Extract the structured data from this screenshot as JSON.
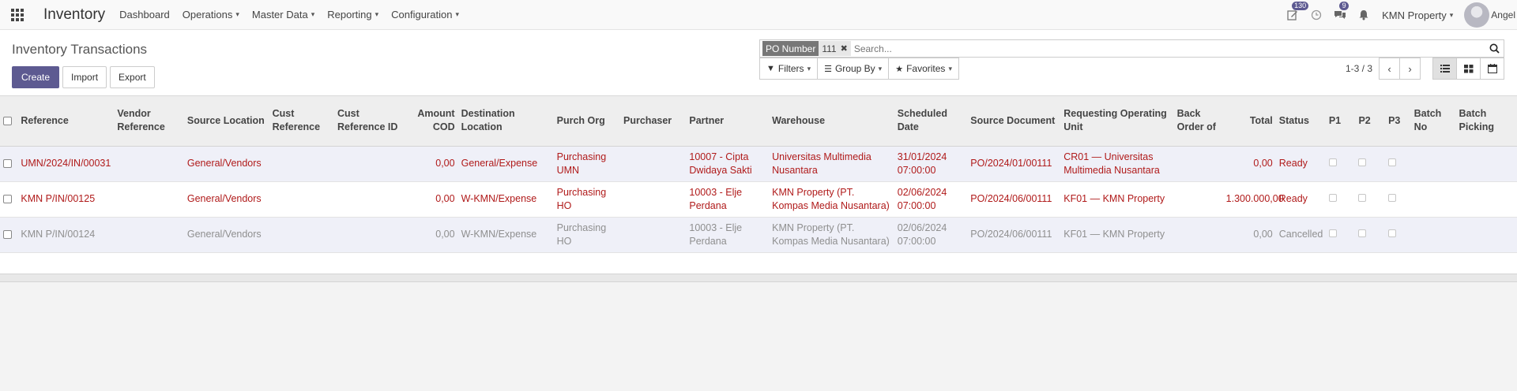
{
  "navbar": {
    "brand": "Inventory",
    "menu": [
      {
        "label": "Dashboard",
        "dropdown": false
      },
      {
        "label": "Operations",
        "dropdown": true
      },
      {
        "label": "Master Data",
        "dropdown": true
      },
      {
        "label": "Reporting",
        "dropdown": true
      },
      {
        "label": "Configuration",
        "dropdown": true
      }
    ],
    "activity_badge": "130",
    "messages_badge": "9",
    "company": "KMN Property",
    "user": "Angel"
  },
  "control_panel": {
    "title": "Inventory Transactions",
    "create_label": "Create",
    "import_label": "Import",
    "export_label": "Export",
    "search": {
      "facet_label": "PO Number",
      "facet_value": "111",
      "placeholder": "Search..."
    },
    "filters_label": "Filters",
    "groupby_label": "Group By",
    "favorites_label": "Favorites",
    "pager": "1-3 / 3"
  },
  "table": {
    "columns": {
      "reference": "Reference",
      "vendor_ref": "Vendor Reference",
      "source_loc": "Source Location",
      "cust_ref": "Cust Reference",
      "cust_ref_id": "Cust Reference ID",
      "amount_cod": "Amount COD",
      "dest_loc": "Destination Location",
      "purch_org": "Purch Org",
      "purchaser": "Purchaser",
      "partner": "Partner",
      "warehouse": "Warehouse",
      "scheduled": "Scheduled Date",
      "source_doc": "Source Document",
      "req_unit": "Requesting Operating Unit",
      "backorder": "Back Order of",
      "total": "Total",
      "status": "Status",
      "p1": "P1",
      "p2": "P2",
      "p3": "P3",
      "batch_no": "Batch No",
      "batch_picking": "Batch Picking"
    },
    "rows": [
      {
        "reference": "UMN/2024/IN/00031",
        "vendor_ref": "",
        "source_loc": "General/Vendors",
        "cust_ref": "",
        "cust_ref_id": "",
        "amount_cod": "0,00",
        "dest_loc": "General/Expense",
        "purch_org": "Purchasing UMN",
        "purchaser": "",
        "partner": "10007 - Cipta Dwidaya Sakti",
        "warehouse": "Universitas Multimedia Nusantara",
        "scheduled": "31/01/2024 07:00:00",
        "source_doc": "PO/2024/01/00111",
        "req_unit": "CR01 — Universitas Multimedia Nusantara",
        "backorder": "",
        "total": "0,00",
        "status": "Ready",
        "batch_no": "",
        "batch_picking": ""
      },
      {
        "reference": "KMN P/IN/00125",
        "vendor_ref": "",
        "source_loc": "General/Vendors",
        "cust_ref": "",
        "cust_ref_id": "",
        "amount_cod": "0,00",
        "dest_loc": "W-KMN/Expense",
        "purch_org": "Purchasing HO",
        "purchaser": "",
        "partner": "10003 - Elje Perdana",
        "warehouse": "KMN Property (PT. Kompas Media Nusantara)",
        "scheduled": "02/06/2024 07:00:00",
        "source_doc": "PO/2024/06/00111",
        "req_unit": "KF01 — KMN Property",
        "backorder": "",
        "total": "1.300.000,00",
        "status": "Ready",
        "batch_no": "",
        "batch_picking": ""
      },
      {
        "reference": "KMN P/IN/00124",
        "vendor_ref": "",
        "source_loc": "General/Vendors",
        "cust_ref": "",
        "cust_ref_id": "",
        "amount_cod": "0,00",
        "dest_loc": "W-KMN/Expense",
        "purch_org": "Purchasing HO",
        "purchaser": "",
        "partner": "10003 - Elje Perdana",
        "warehouse": "KMN Property (PT. Kompas Media Nusantara)",
        "scheduled": "02/06/2024 07:00:00",
        "source_doc": "PO/2024/06/00111",
        "req_unit": "KF01 — KMN Property",
        "backorder": "",
        "total": "0,00",
        "status": "Cancelled",
        "batch_no": "",
        "batch_picking": ""
      }
    ]
  },
  "colors": {
    "primary": "#5d5a91",
    "ready_text": "#b01a1a",
    "cancelled_text": "#8f8f8f",
    "alt_row": "#eff0f8"
  }
}
